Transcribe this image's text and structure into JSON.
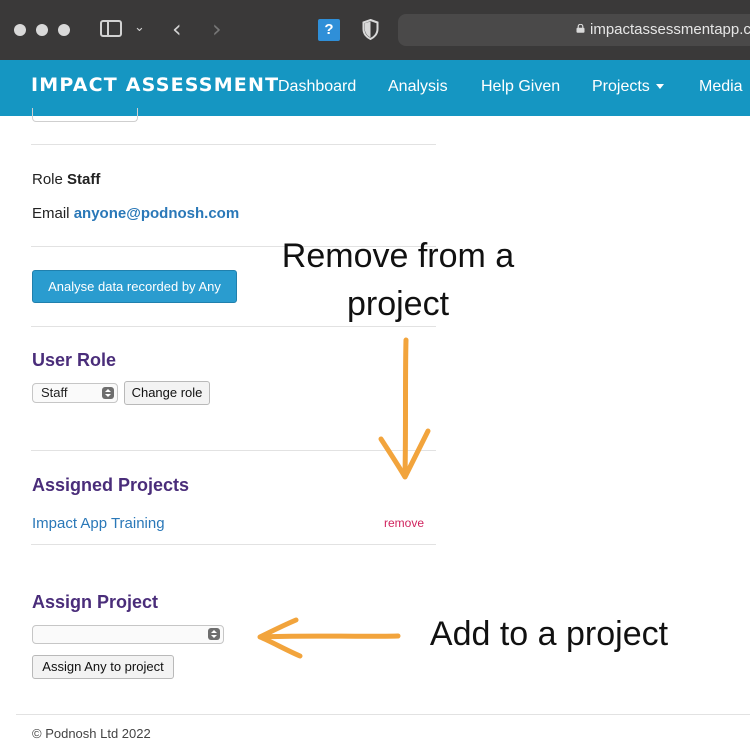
{
  "browser": {
    "url": "impactassessmentapp.c",
    "extension_icon": "?"
  },
  "nav": {
    "brand": "IMPACT ASSESSMENT",
    "items": [
      {
        "label": "Dashboard"
      },
      {
        "label": "Analysis"
      },
      {
        "label": "Help Given"
      },
      {
        "label": "Projects"
      },
      {
        "label": "Media"
      }
    ]
  },
  "user": {
    "role_label": "Role",
    "role_value": "Staff",
    "email_label": "Email",
    "email_value": "anyone@podnosh.com",
    "analyse_button": "Analyse data recorded by Any"
  },
  "user_role": {
    "title": "User Role",
    "selected": "Staff",
    "change_button": "Change role"
  },
  "assigned_projects": {
    "title": "Assigned Projects",
    "projects": [
      {
        "name": "Impact App Training",
        "action": "remove"
      }
    ]
  },
  "assign_project": {
    "title": "Assign Project",
    "selected": "",
    "button": "Assign Any to project"
  },
  "footer": {
    "text": "© Podnosh Ltd 2022"
  },
  "annotations": {
    "remove": {
      "line1": "Remove from a",
      "line2": "project"
    },
    "add": "Add to a project"
  },
  "colors": {
    "navbar": "#1596c2",
    "section_title": "#4a2d7a",
    "link": "#2a78b8",
    "remove_link": "#d0245e",
    "annotation_arrow": "#f2a43c"
  }
}
